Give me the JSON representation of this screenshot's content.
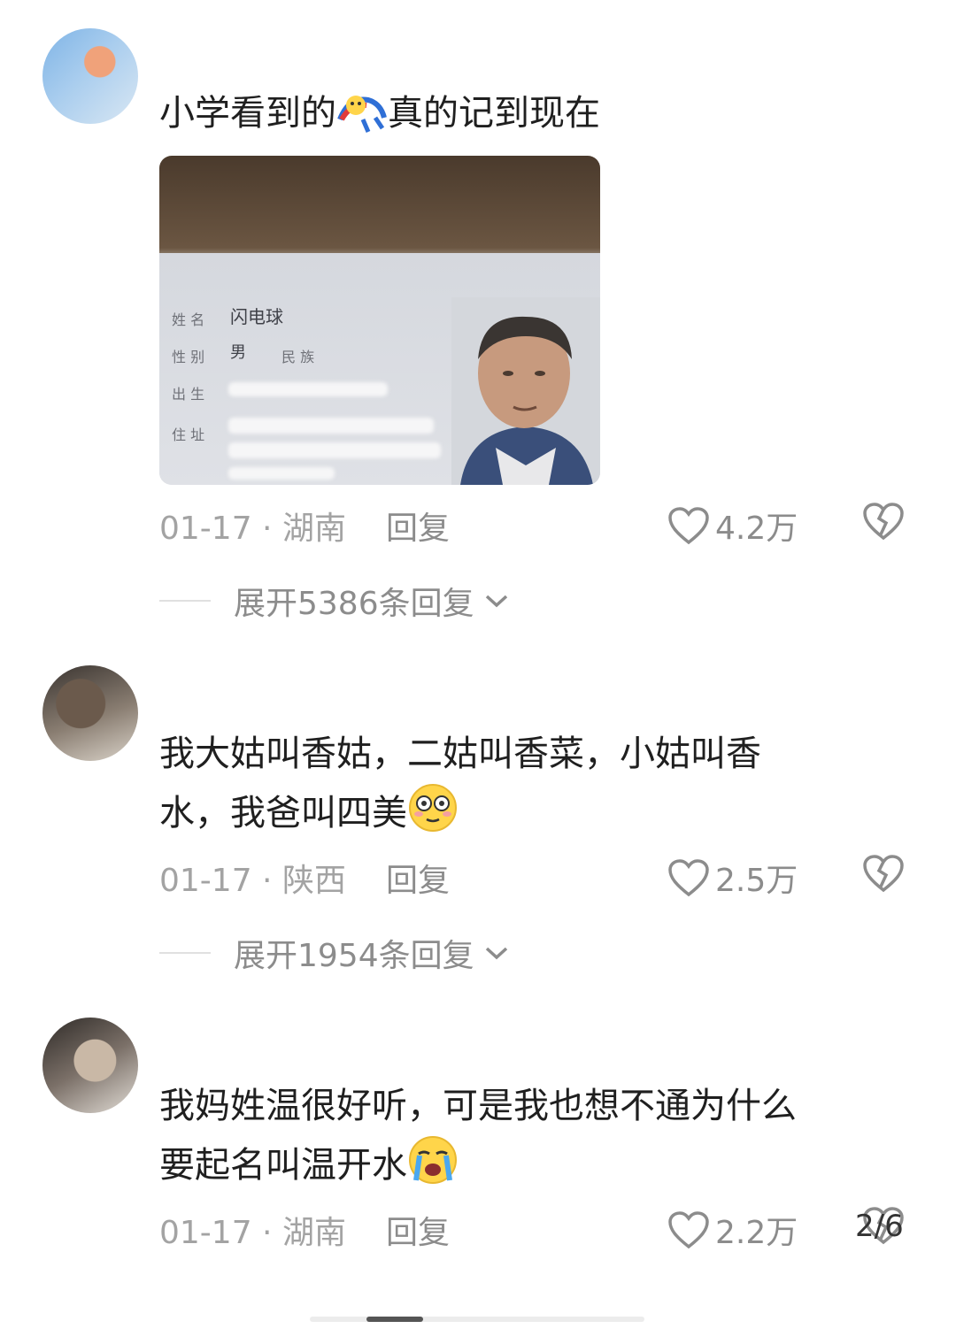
{
  "comments": [
    {
      "text_before": "小学看到的",
      "emoji_name": "clown-crying-emoji",
      "text_after": "真的记到现在",
      "date": "01-17 · 湖南",
      "reply_label": "回复",
      "likes": "4.2万",
      "expand_label": "展开5386条回复",
      "id_card": {
        "name_label": "姓 名",
        "name_value": "闪电球",
        "sex_label": "性 别",
        "sex_value": "男",
        "ethnic_label": "民 族",
        "birth_label": "出 生",
        "address_label": "住 址"
      }
    },
    {
      "text_line1": "我大姑叫香姑，二姑叫香菜，小姑叫香",
      "text_line2": "水，我爸叫四美",
      "emoji_name": "flushed-emoji",
      "date": "01-17 · 陕西",
      "reply_label": "回复",
      "likes": "2.5万",
      "expand_label": "展开1954条回复"
    },
    {
      "text_line1": "我妈姓温很好听，可是我也想不通为什么",
      "text_line2": "要起名叫温开水",
      "emoji_name": "loudly-crying-emoji",
      "date": "01-17 · 湖南",
      "reply_label": "回复",
      "likes": "2.2万"
    }
  ],
  "pager": "2/6",
  "colors": {
    "text": "#1f1f1f",
    "meta": "#a3a3a3",
    "icon": "#8c8c8c"
  }
}
